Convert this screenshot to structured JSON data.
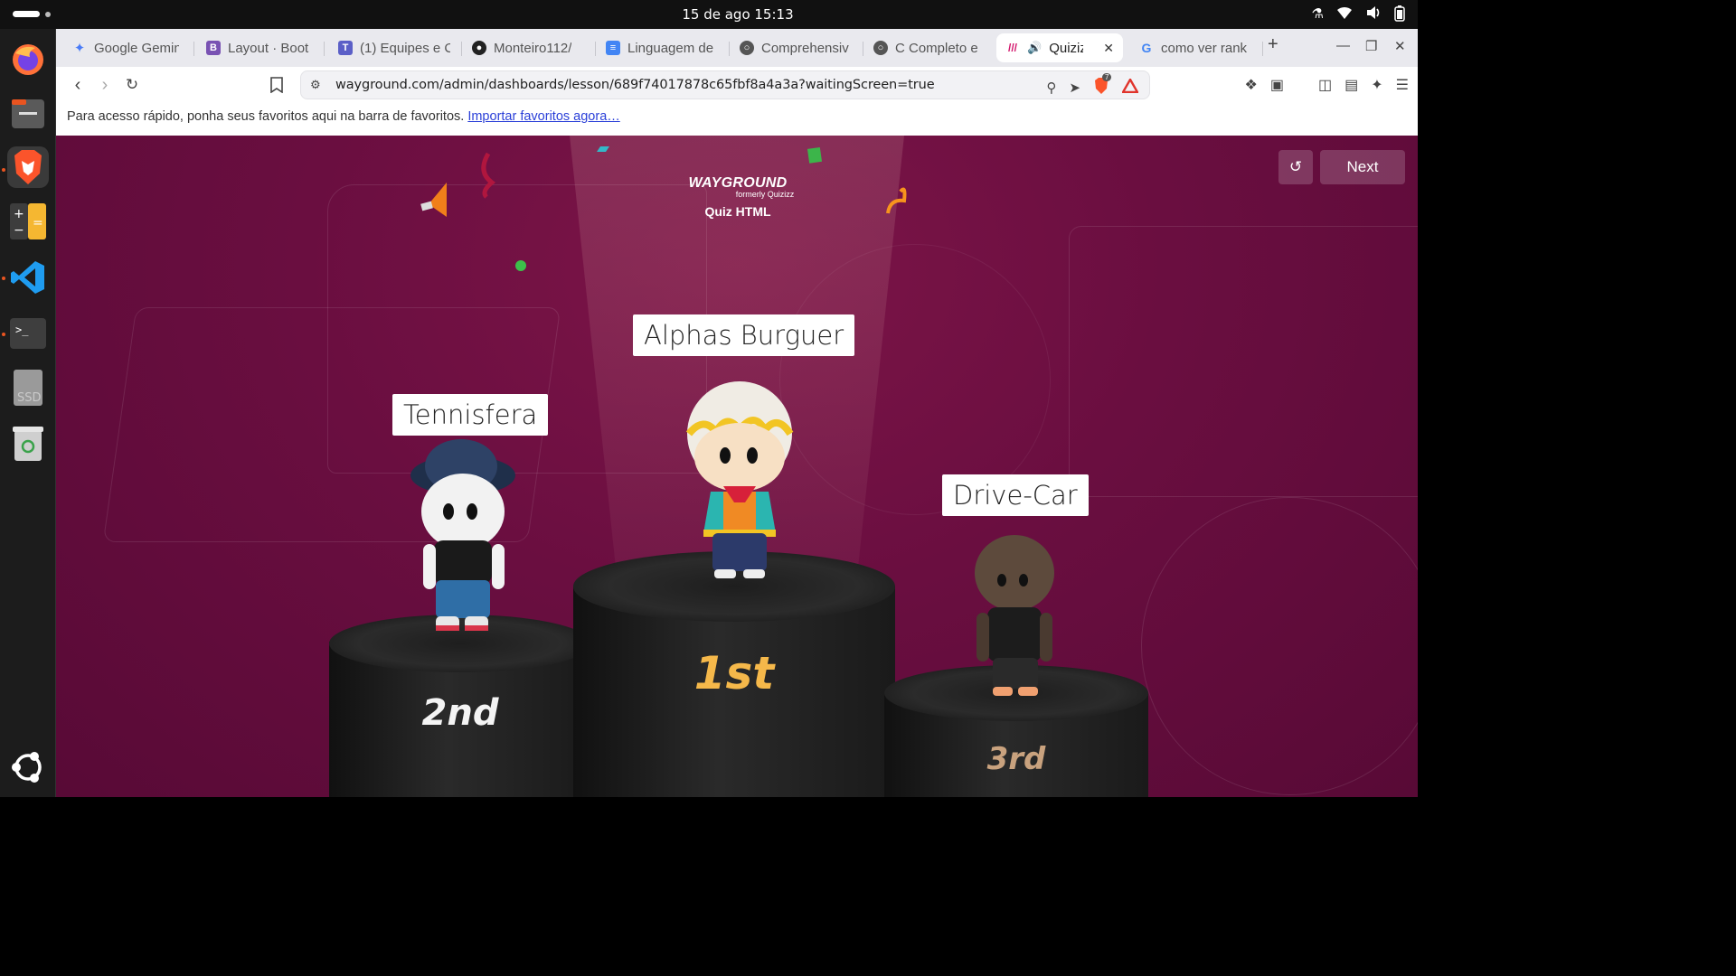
{
  "system": {
    "clock": "15 de ago  15:13"
  },
  "dock": {
    "apps": [
      "firefox-icon",
      "files-icon",
      "brave-icon",
      "calculator-icon",
      "vscode-icon",
      "terminal-icon",
      "ssd-drive-icon",
      "trash-icon",
      "ubuntu-apps-icon"
    ],
    "ssd_label": "SSD"
  },
  "tabs": [
    {
      "label": "Google Gemin",
      "icon": "gemini-icon"
    },
    {
      "label": "Layout · Boots",
      "icon": "bootstrap-icon"
    },
    {
      "label": "(1) Equipes e C",
      "icon": "teams-icon"
    },
    {
      "label": "Monteiro112/",
      "icon": "github-icon"
    },
    {
      "label": "Linguagem de",
      "icon": "docs-icon"
    },
    {
      "label": "Comprehensiv",
      "icon": "globe-icon"
    },
    {
      "label": "C Completo e",
      "icon": "globe-icon"
    },
    {
      "label": "Quizizz",
      "icon": "quizizz-icon",
      "active": true
    },
    {
      "label": "como ver rank",
      "icon": "google-icon"
    }
  ],
  "toolbar": {
    "url": "wayground.com/admin/dashboards/lesson/689f74017878c65fbf8a4a3a?waitingScreen=true",
    "brave_badge": "7"
  },
  "bookmarks": {
    "message": "Para acesso rápido, ponha seus favoritos aqui na barra de favoritos.",
    "import_link": "Importar favoritos agora…"
  },
  "page": {
    "brand_logo": "WAYGROUND",
    "brand_sub": "formerly Quizizz",
    "quiz_title": "Quiz HTML",
    "next_label": "Next",
    "podium": [
      {
        "rank": "1st",
        "name": "Alphas Burguer"
      },
      {
        "rank": "2nd",
        "name": "Tennisfera"
      },
      {
        "rank": "3rd",
        "name": "Drive-Car"
      }
    ]
  }
}
